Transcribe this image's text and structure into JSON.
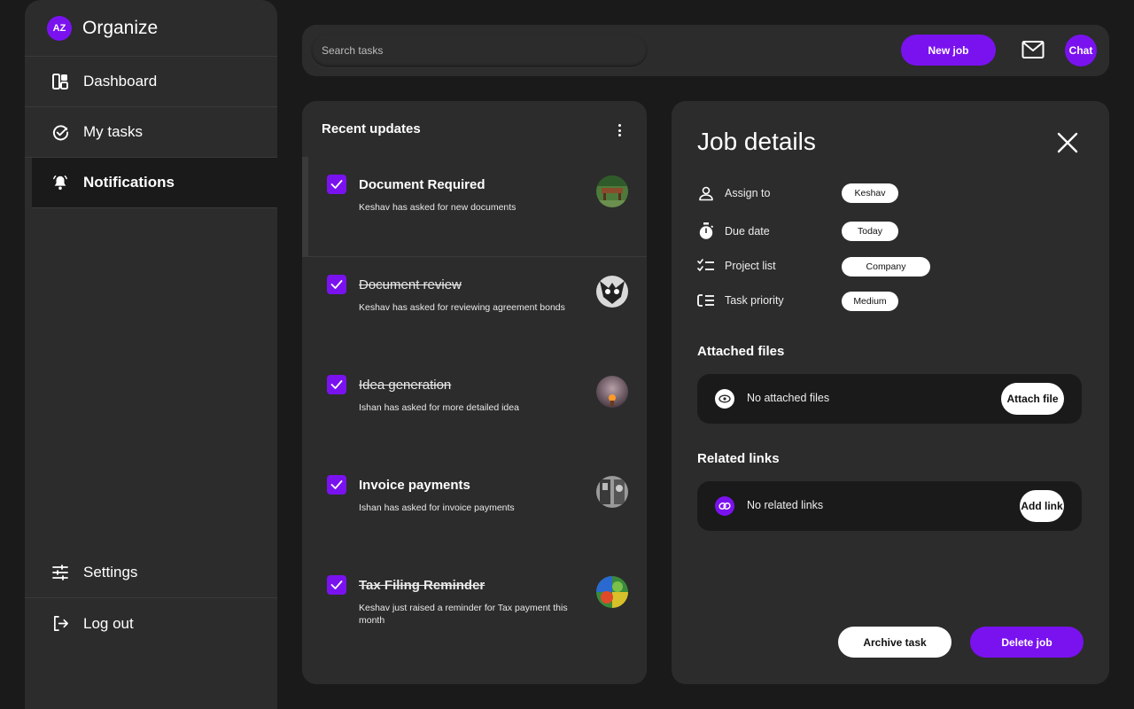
{
  "app": {
    "name": "Organize",
    "logo_text": "AZ"
  },
  "sidebar": {
    "items": [
      {
        "label": "Dashboard",
        "icon": "dashboard-icon"
      },
      {
        "label": "My tasks",
        "icon": "check-circle-icon"
      },
      {
        "label": "Notifications",
        "icon": "bell-icon",
        "active": true
      }
    ],
    "bottom_items": [
      {
        "label": "Settings",
        "icon": "sliders-icon"
      },
      {
        "label": "Log out",
        "icon": "logout-icon"
      }
    ]
  },
  "topbar": {
    "search_placeholder": "Search tasks",
    "new_job_label": "New job",
    "mail_icon": "mail-icon",
    "chat_label": "Chat"
  },
  "updates": {
    "title": "Recent updates",
    "tasks": [
      {
        "title": "Document Required",
        "subtitle": "Keshav has asked for new documents",
        "checked": true,
        "struck": false
      },
      {
        "title": "Document review",
        "subtitle": "Keshav has asked for reviewing agreement bonds",
        "checked": true,
        "struck": true
      },
      {
        "title": "Idea generation",
        "subtitle": "Ishan has asked for more detailed idea",
        "checked": true,
        "struck": true
      },
      {
        "title": "Invoice payments",
        "subtitle": "Ishan has asked for invoice payments",
        "checked": true,
        "struck": false
      },
      {
        "title": "Tax Filing Reminder",
        "subtitle": "Keshav just raised a reminder for Tax payment this month",
        "checked": true,
        "struck": true
      }
    ]
  },
  "details": {
    "title": "Job details",
    "fields": [
      {
        "label": "Assign to",
        "value": "Keshav",
        "icon": "person-icon"
      },
      {
        "label": "Due date",
        "value": "Today",
        "icon": "stopwatch-icon"
      },
      {
        "label": "Project list",
        "value": "Company",
        "icon": "checklist-icon"
      },
      {
        "label": "Task priority",
        "value": "Medium",
        "icon": "priority-list-icon"
      }
    ],
    "attached_files": {
      "title": "Attached files",
      "empty_text": "No attached files",
      "button": "Attach file"
    },
    "related_links": {
      "title": "Related links",
      "empty_text": "No related links",
      "button": "Add link"
    },
    "archive_label": "Archive task",
    "delete_label": "Delete job"
  },
  "colors": {
    "accent": "#7a12f0",
    "panel": "#2c2c2c",
    "background": "#1a1a1a"
  }
}
